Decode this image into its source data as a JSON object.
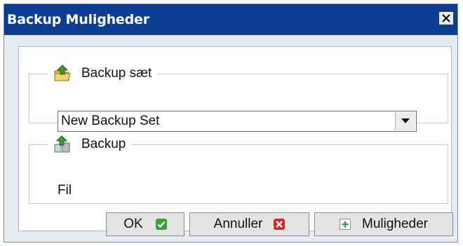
{
  "dialog": {
    "title": "Backup Muligheder",
    "close_icon": "close-icon"
  },
  "backup_set_group": {
    "legend": "Backup sæt",
    "icon": "folder-upload-icon",
    "select": {
      "selected": "New Backup Set",
      "arrow_icon": "dropdown-arrow-icon"
    }
  },
  "backup_group": {
    "legend": "Backup",
    "icon": "backup-upload-icon",
    "type_value": "Fil"
  },
  "buttons": {
    "ok": {
      "label": "OK",
      "icon": "check-icon",
      "color": "#3aa23a"
    },
    "cancel": {
      "label": "Annuller",
      "icon": "cross-icon",
      "color": "#d9262b"
    },
    "options": {
      "label": "Muligheder",
      "icon": "plus-icon",
      "color": "#3aa23a"
    }
  },
  "colors": {
    "titlebar": "#0b3e92",
    "window": "#e6eaf2"
  }
}
